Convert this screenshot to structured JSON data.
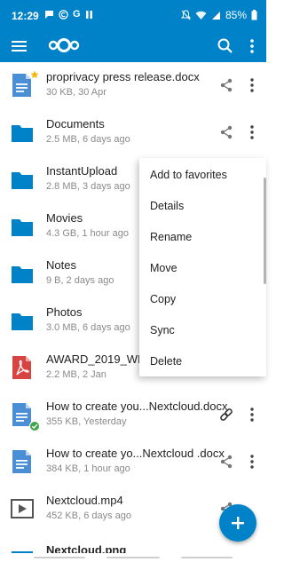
{
  "status_bar": {
    "time": "12:29",
    "battery": "85%",
    "left_icons": [
      "chat-bubble-icon",
      "copyright-icon",
      "google-g-icon",
      "pause-icon"
    ],
    "right_icons": [
      "mute-icon",
      "wifi-icon",
      "signal-icon",
      "battery-icon"
    ]
  },
  "app_bar": {
    "menu_icon": "hamburger-menu-icon",
    "logo_icon": "nextcloud-logo-icon",
    "search_icon": "search-icon",
    "more_icon": "more-vertical-icon"
  },
  "files": [
    {
      "name": "proprivacy press release.docx",
      "meta": "30 KB, 30 Apr",
      "icon": "document-icon",
      "favorite": true,
      "share_icon": "share-icon"
    },
    {
      "name": "Documents",
      "meta": "2.5 MB, 6 days ago",
      "icon": "folder-icon",
      "share_icon": "share-icon"
    },
    {
      "name": "InstantUpload",
      "meta": "2.8 MB, 3 days ago",
      "icon": "folder-icon"
    },
    {
      "name": "Movies",
      "meta": "4.3 GB, 1 hour ago",
      "icon": "folder-icon"
    },
    {
      "name": "Notes",
      "meta": "9 B, 2 days ago",
      "icon": "folder-icon"
    },
    {
      "name": "Photos",
      "meta": "3.0 MB, 6 days ago",
      "icon": "folder-icon"
    },
    {
      "name": "AWARD_2019_WH...",
      "meta": "2.2 MB, 2 Jan",
      "icon": "pdf-icon"
    },
    {
      "name": "How to create you...Nextcloud.docx",
      "meta": "355 KB, Yesterday",
      "icon": "document-icon",
      "synced": true,
      "share_icon": "link-icon"
    },
    {
      "name": "How to create yo...Nextcloud .docx",
      "meta": "384 KB, 1 hour ago",
      "icon": "document-icon",
      "share_icon": "share-icon"
    },
    {
      "name": "Nextcloud.mp4",
      "meta": "452 KB, 6 days ago",
      "icon": "video-icon",
      "share_icon": "share-icon"
    },
    {
      "name": "Nextcloud.png",
      "meta": "",
      "icon": "image-icon"
    }
  ],
  "context_menu": {
    "items": [
      "Add to favorites",
      "Details",
      "Rename",
      "Move",
      "Copy",
      "Sync",
      "Delete"
    ]
  },
  "fab": {
    "icon": "plus-icon"
  },
  "colors": {
    "brand": "#0082c9",
    "folder": "#0082c9",
    "document": "#4a8fd6",
    "pdf": "#d64541",
    "sync_ok": "#3fa54a",
    "favorite": "#f4b400"
  }
}
